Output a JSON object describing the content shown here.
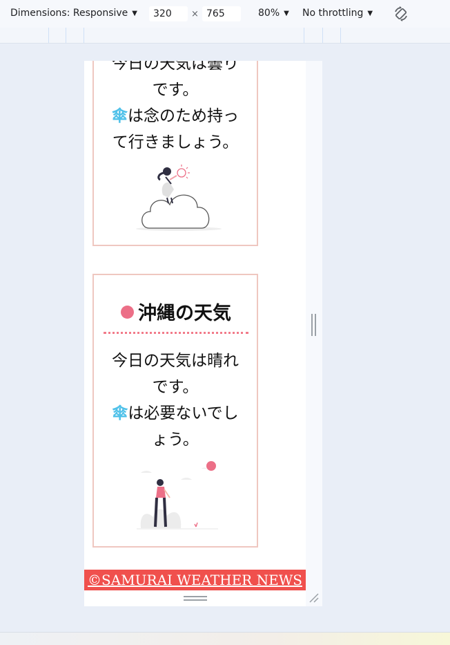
{
  "toolbar": {
    "dimensions_label": "Dimensions: Responsive",
    "width_value": "320",
    "times_sign": "×",
    "height_value": "765",
    "zoom_label": "80%",
    "throttling_label": "No throttling",
    "caret_glyph": "▼",
    "rotate_icon": "rotate-icon"
  },
  "page": {
    "card1": {
      "line1": "今日の天気は曇り",
      "line2": "です。",
      "umbrella_glyph": "傘",
      "line3": "は念のため持っ",
      "line4": "て行きましょう。"
    },
    "card2": {
      "title": "沖縄の天気",
      "line1": "今日の天気は晴れ",
      "line2": "です。",
      "umbrella_glyph": "傘",
      "line3": "は必要ないでし",
      "line4": "ょう。"
    },
    "footer": "©SAMURAI WEATHER NEWS"
  },
  "colors": {
    "accent_pink": "#ec6f87",
    "umbrella_blue": "#4fc1e9",
    "footer_red": "#f0504d",
    "card_border": "#efc7c0"
  }
}
